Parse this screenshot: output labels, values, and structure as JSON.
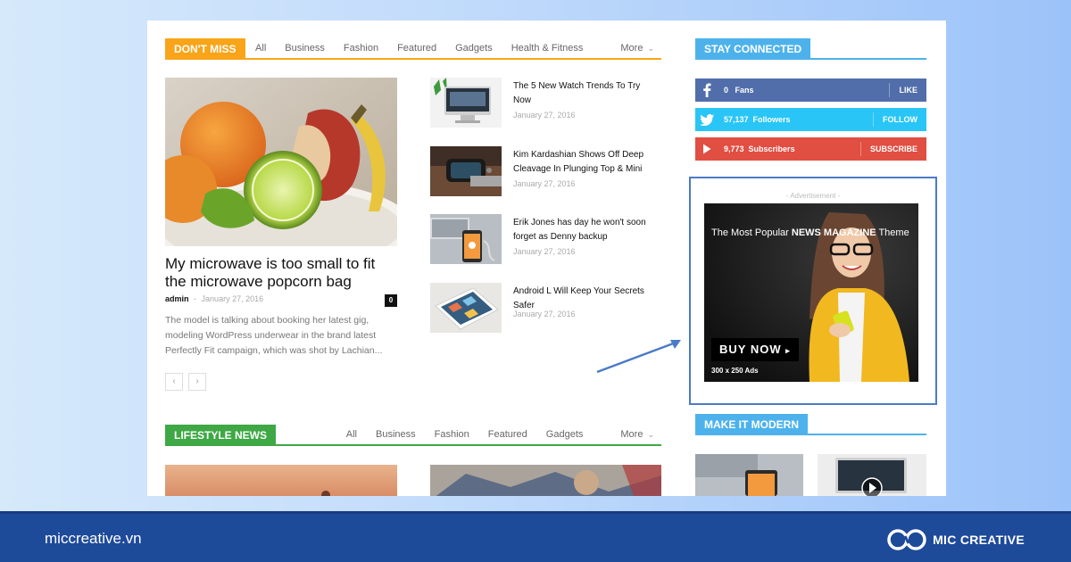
{
  "dont_miss": {
    "title": "DON'T MISS",
    "filters": [
      "All",
      "Business",
      "Fashion",
      "Featured",
      "Gadgets",
      "Health & Fitness"
    ],
    "more_label": "More",
    "featured": {
      "title": "My microwave is too small to fit the microwave popcorn bag",
      "author": "admin",
      "separator": "-",
      "date": "January 27, 2016",
      "comments": "0",
      "excerpt": "The model is talking about booking her latest gig, modeling WordPress underwear in the brand latest Perfectly Fit campaign, which was shot by Lachian..."
    },
    "pager": {
      "prev": "‹",
      "next": "›"
    },
    "articles": [
      {
        "title": "The 5 New Watch Trends To Try Now",
        "date": "January 27, 2016"
      },
      {
        "title": "Kim Kardashian Shows Off Deep Cleavage In Plunging Top & Mini",
        "date": "January 27, 2016"
      },
      {
        "title": "Erik Jones has day he won't soon forget as Denny backup",
        "date": "January 27, 2016"
      },
      {
        "title": "Android L Will Keep Your Secrets Safer",
        "date": "January 27, 2016"
      }
    ]
  },
  "lifestyle": {
    "title": "LIFESTYLE NEWS",
    "filters": [
      "All",
      "Business",
      "Fashion",
      "Featured",
      "Gadgets"
    ],
    "more_label": "More"
  },
  "sidebar": {
    "stay_connected": "STAY CONNECTED",
    "social": [
      {
        "icon": "facebook-icon",
        "count": "0",
        "unit": "Fans",
        "action": "LIKE",
        "color": "#516eab"
      },
      {
        "icon": "twitter-icon",
        "count": "57,137",
        "unit": "Followers",
        "action": "FOLLOW",
        "color": "#29c5f6"
      },
      {
        "icon": "youtube-icon",
        "count": "9,773",
        "unit": "Subscribers",
        "action": "SUBSCRIBE",
        "color": "#e14e42"
      }
    ],
    "ad": {
      "label": "- Advertisement -",
      "headline_prefix": "The Most Popular ",
      "headline_strong": "NEWS MAGAZINE",
      "headline_suffix": " Theme",
      "button": "BUY NOW",
      "size": "300 x 250 Ads"
    },
    "make_it_modern": "MAKE IT MODERN"
  },
  "footer": {
    "site": "miccreative.vn",
    "brand": "MIC CREATIVE"
  },
  "colors": {
    "dont_miss": "#f9a419",
    "lifestyle": "#4db2ec",
    "lifestyle_green": "#3ea845",
    "sidebar_blue": "#4db2ec",
    "footer": "#1e4a9a",
    "callout_arrow": "#4a7bc8"
  }
}
